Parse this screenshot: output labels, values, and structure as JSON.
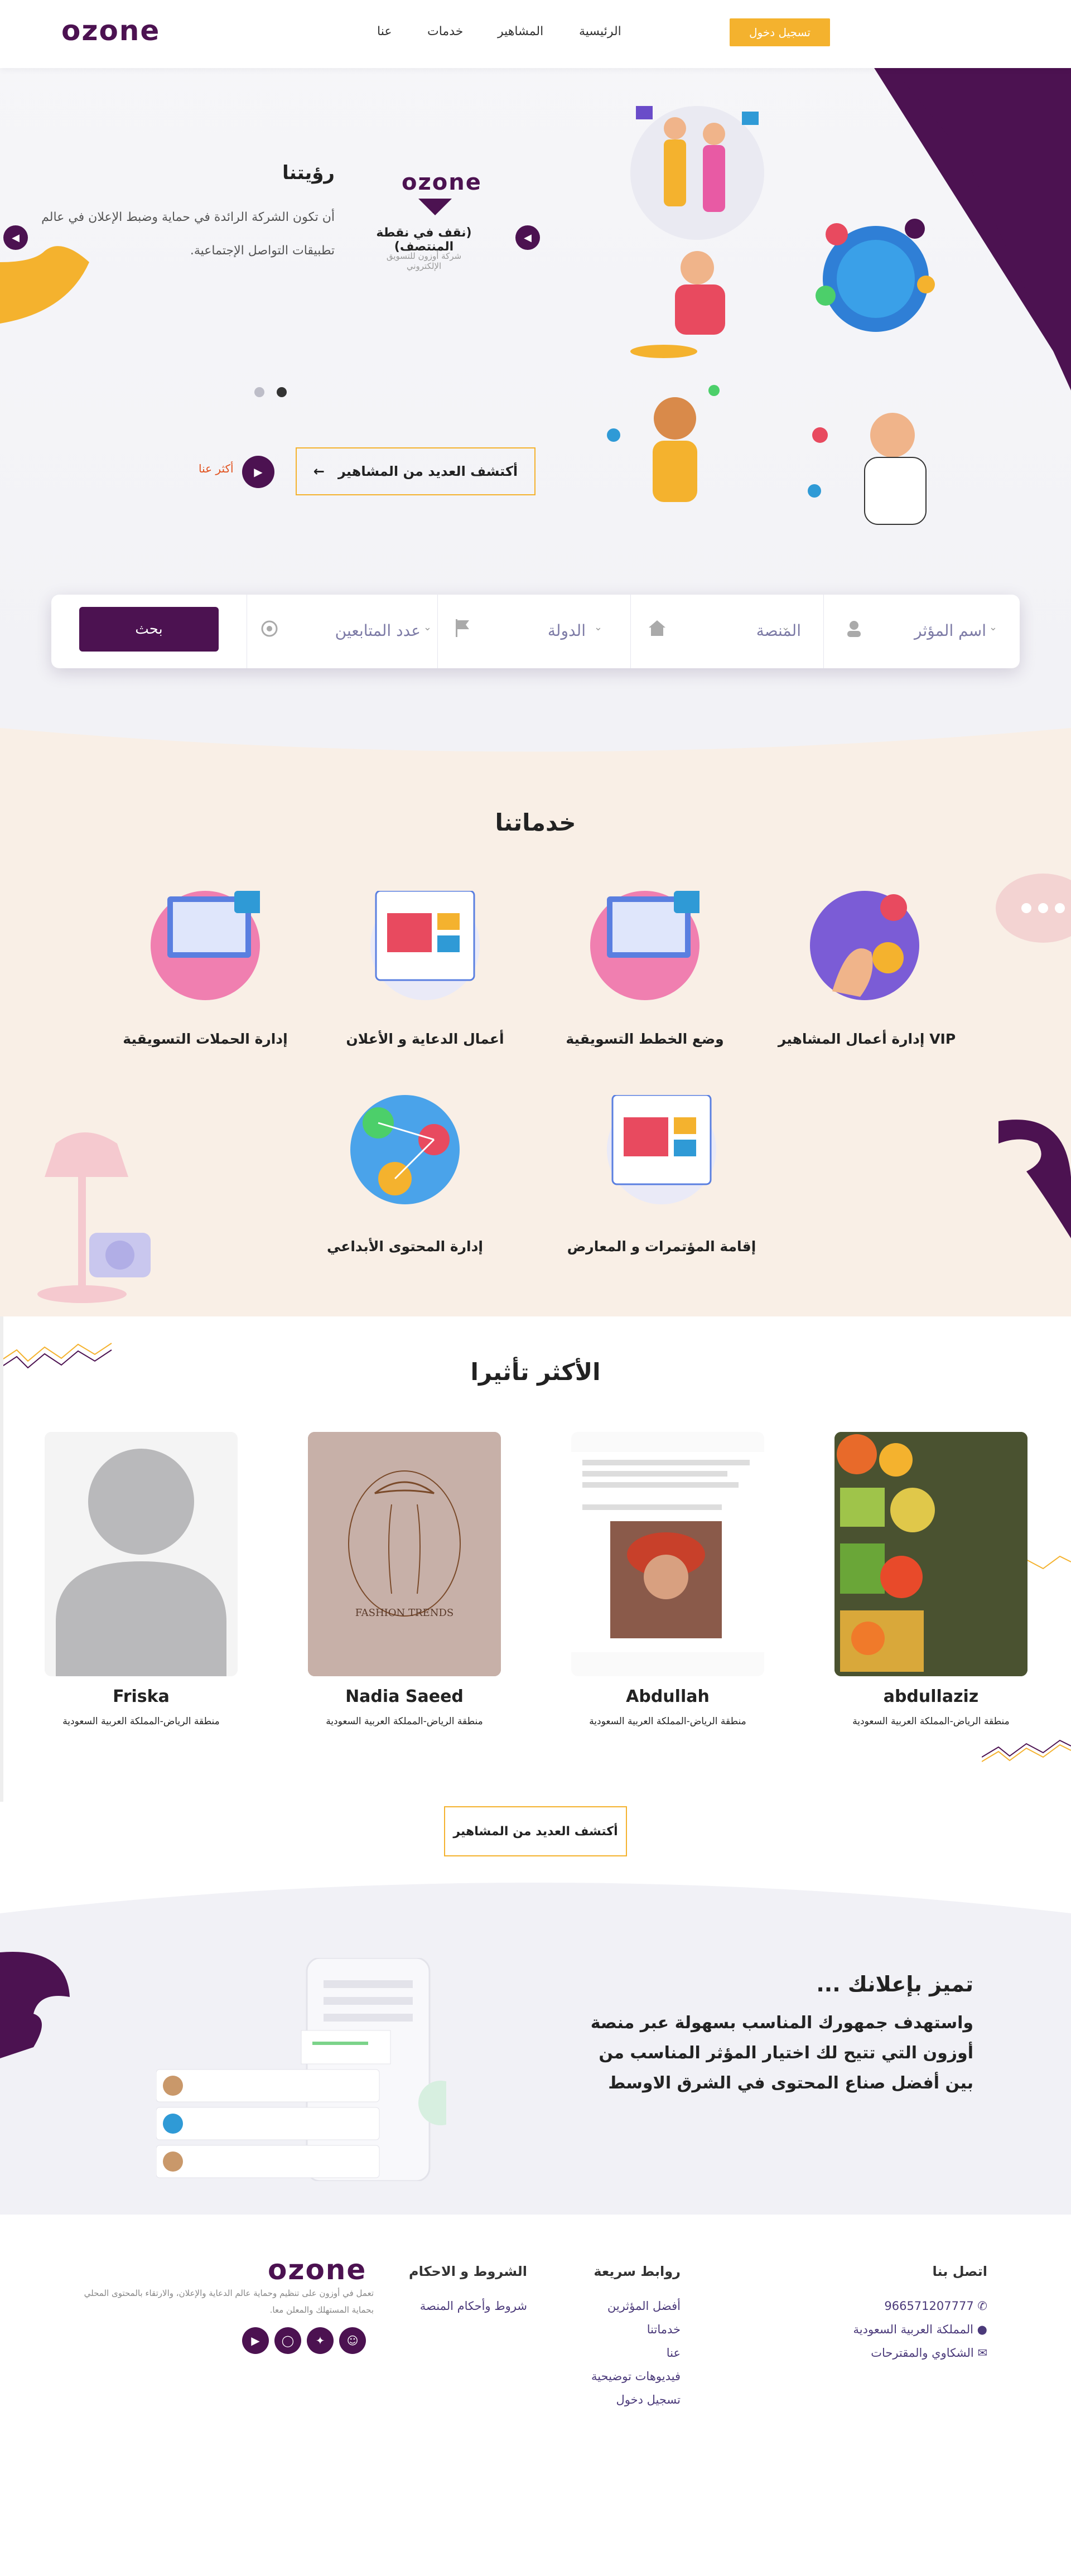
{
  "header": {
    "logo": "ozone",
    "nav": [
      "الرئيسية",
      "المشاهير",
      "خدمات",
      "عنا"
    ],
    "login": "تسجيل دخول"
  },
  "hero": {
    "vision_title": "رؤيتنا",
    "vision_text": "أن تكون الشركة الرائدة في حماية وضبط الإعلان في عالم تطبيقات التواصل الإجتماعية.",
    "logo": "ozone",
    "tagline": "(نقف في نقطة المنتصف)",
    "subtitle": "شركة أوزون للتسويق الإلكتروني",
    "discover_button": "أكتشف العديد من المشاهير",
    "more_link": "أكثر عنا"
  },
  "search": {
    "fields": [
      {
        "label": "اسم المؤثر",
        "icon": "user-icon"
      },
      {
        "label": "المنصة",
        "icon": "home-icon"
      },
      {
        "label": "الدولة",
        "icon": "flag-icon"
      },
      {
        "label": "عدد المتابعين",
        "icon": "target-icon"
      }
    ],
    "button": "بحث"
  },
  "services": {
    "title": "خدماتنا",
    "items": [
      "VIP إدارة أعمال المشاهير",
      "وضع الخطط التسويقية",
      "أعمال الدعاية و الأعلان",
      "إدارة الحملات التسويقية",
      "إقامة المؤتمرات و المعارض",
      "إدارة المحتوى الأبداعي"
    ]
  },
  "influencers": {
    "title": "الأكثر تأثيرا",
    "cards": [
      {
        "name": "abdullaziz",
        "location": "منطقة الرياض-المملكة العربية السعودية"
      },
      {
        "name": "Abdullah",
        "location": "منطقة الرياض-المملكة العربية السعودية"
      },
      {
        "name": "Nadia Saeed",
        "location": "منطقة الرياض-المملكة العربية السعودية"
      },
      {
        "name": "Friska",
        "location": "منطقة الرياض-المملكة العربية السعودية"
      }
    ],
    "more_button": "أكتشف العديد من المشاهير",
    "fashion_text": "FASHION TRENDS"
  },
  "promo": {
    "title": "تميز بإعلانك ...",
    "text": "واستهدف جمهورك المناسب بسهولة عبر منصة أوزون التي تتيح لك اختيار المؤثر المناسب من بين أفضل صناع المحتوى في الشرق الاوسط"
  },
  "footer": {
    "contact_title": "اتصل بنا",
    "phone": "966571207777",
    "country": "المملكة العربية السعودية",
    "complaints": "الشكاوي والمقترحات",
    "links_title": "روابط سريعة",
    "links": [
      "أفضل المؤثرين",
      "خدماتنا",
      "عنا",
      "فيديوهات توضيحية",
      "تسجيل دخول"
    ],
    "terms_title": "الشروط و الاحكام",
    "terms_link": "شروط وأحكام المنصة",
    "logo": "ozone",
    "about": "تعمل في أوزون على تنظيم وحماية عالم الدعاية والإعلان، والارتقاء بالمحتوى المحلي بحماية المستهلك والمعلن معا.",
    "social_icons": [
      "youtube-icon",
      "instagram-icon",
      "twitter-icon",
      "snapchat-icon"
    ]
  },
  "colors": {
    "primary": "#4c1251",
    "accent": "#f4b22e",
    "services_bg": "#f9efe6"
  }
}
